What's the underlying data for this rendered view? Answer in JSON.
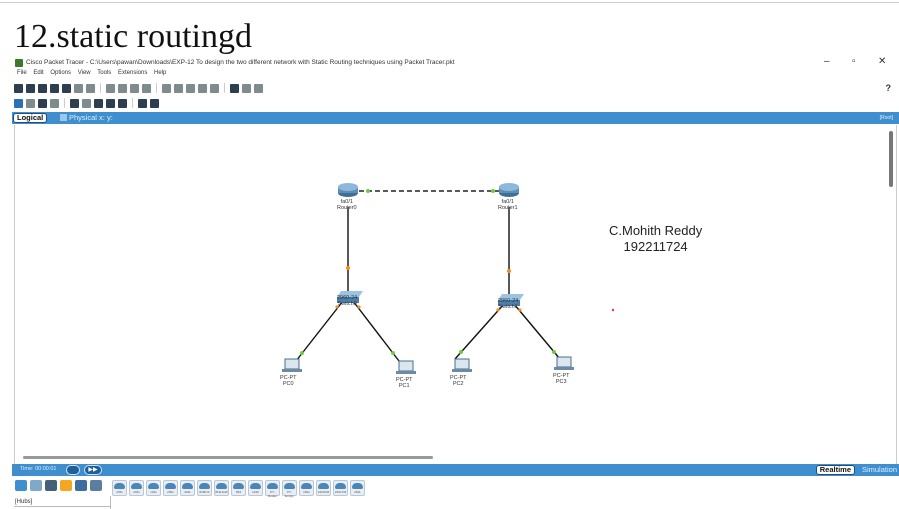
{
  "slide": {
    "title": "12.static routingd"
  },
  "window": {
    "title": "Cisco Packet Tracer - C:\\Users\\pawan\\Downloads\\EXP-12 To design the two different network with Static Routing techniques using Packet Tracer.pkt",
    "controls": {
      "minimize": "–",
      "maximize": "▫",
      "close": "✕"
    }
  },
  "menu": [
    "File",
    "Edit",
    "Options",
    "View",
    "Tools",
    "Extensions",
    "Help"
  ],
  "help_label": "?",
  "tabs": {
    "logical": "Logical",
    "physical": "Physical",
    "coords": "x: y:"
  },
  "tab_right": "[Root]",
  "devices": {
    "router0": {
      "port": "fa0/1",
      "name": "Router0"
    },
    "router1": {
      "port": "fa0/1",
      "name": "Router1"
    },
    "switch0": {
      "model": "2960-24",
      "name": "Switch0"
    },
    "switch1": {
      "model": "2960-24",
      "name": "Switch1"
    },
    "pc0": {
      "model": "PC-PT",
      "name": "PC0"
    },
    "pc1": {
      "model": "PC-PT",
      "name": "PC1"
    },
    "pc2": {
      "model": "PC-PT",
      "name": "PC2"
    },
    "pc3": {
      "model": "PC-PT",
      "name": "PC3"
    }
  },
  "annotation": {
    "name": "C.Mohith Reddy",
    "id": "192211724"
  },
  "bottom": {
    "time": "Time: 00:00:01",
    "realtime": "Realtime",
    "simulation": "Simulation"
  },
  "device_panel": {
    "category": "[Hubs]",
    "models": [
      "4331",
      "4321",
      "1941",
      "2901",
      "2911",
      "819IOX",
      "819HGW",
      "829",
      "1240",
      "PT-Router",
      "PT-Empty",
      "1841",
      "2620XM",
      "2621XM",
      "2811"
    ]
  },
  "colors": {
    "accent_bar": "#3f8fcf",
    "link_light": "#6bcf3c",
    "link_orange": "#f28c28"
  }
}
